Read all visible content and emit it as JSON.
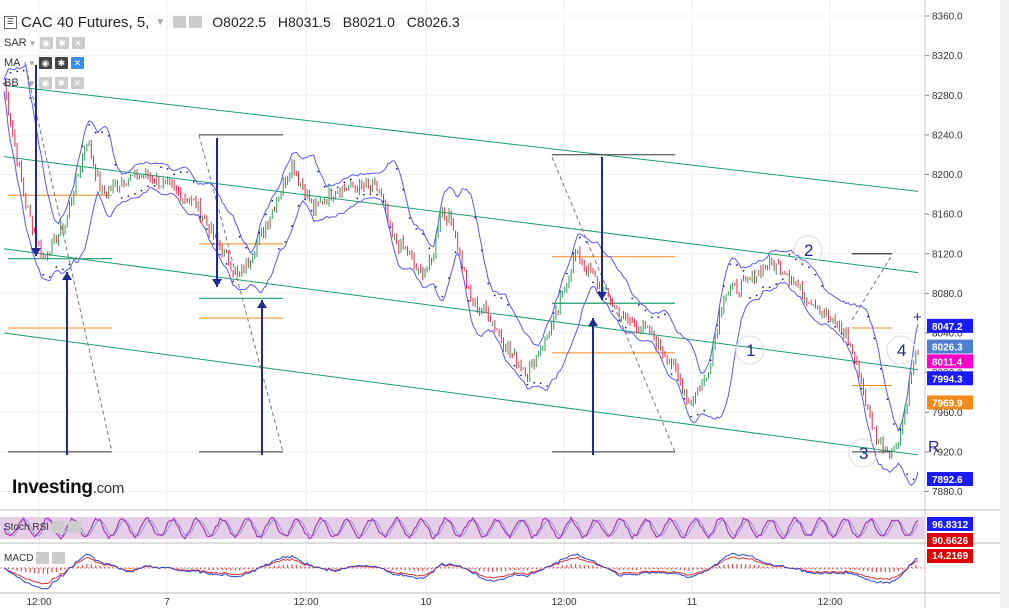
{
  "header": {
    "title": "CAC 40 Futures, 5,",
    "open": "O8022.5",
    "high": "H8031.5",
    "low": "B8021.0",
    "close": "C8026.3"
  },
  "indicators": [
    {
      "name": "SAR"
    },
    {
      "name": "MA"
    },
    {
      "name": "BB"
    }
  ],
  "logo": {
    "main": "Investing",
    "suffix": ".com"
  },
  "stoch_label": "Stoch RSI",
  "macd_label": "MACD",
  "price_badges": [
    {
      "label": "8047.2",
      "value": 8047.2,
      "color": "#1a1aff"
    },
    {
      "label": "8026.3",
      "value": 8026.3,
      "color": "#4f7fd1"
    },
    {
      "label": "8011.4",
      "value": 8011.4,
      "color": "#ff00c8"
    },
    {
      "label": "7994.3",
      "value": 7994.3,
      "color": "#1a1aff"
    },
    {
      "label": "7969.9",
      "value": 7969.9,
      "color": "#f28a1b"
    },
    {
      "label": "7892.6",
      "value": 7892.6,
      "color": "#1a1aff"
    }
  ],
  "stoch_badges": [
    {
      "label": "96.8312",
      "color": "#1a1aff"
    },
    {
      "label": "90.6626",
      "color": "#e00000"
    }
  ],
  "macd_badges": [
    {
      "label": "14.2169",
      "color": "#e00000"
    }
  ],
  "wave_labels": [
    "1",
    "2",
    "3",
    "4"
  ],
  "r_label": "R",
  "plus_label": "+",
  "colors": {
    "up": "#2e9e5a",
    "down": "#e0304a",
    "channel": "#1aa06b",
    "bollinger": "#5a5ae6",
    "arrow": "#1f2a8a",
    "orange": "#f28a1b",
    "green_line": "#1aa06b",
    "stoch": "#a040b0",
    "stoch_bg": "#e6cde8"
  },
  "chart_data": {
    "type": "candlestick",
    "title": "CAC 40 Futures, 5,",
    "y_axis": {
      "ticks": [
        "8360.0",
        "8320.0",
        "8280.0",
        "8240.0",
        "8200.0",
        "8160.0",
        "8120.0",
        "8080.0",
        "8040.0",
        "8000.0",
        "7960.0",
        "7920.0",
        "7880.0"
      ],
      "range": [
        7870,
        8370
      ]
    },
    "x_axis": {
      "ticks": [
        "12:00",
        "7",
        "12:00",
        "10",
        "12:00",
        "11",
        "12:00"
      ]
    },
    "price_path": [
      [
        0,
        8290
      ],
      [
        10,
        8170
      ],
      [
        18,
        8115
      ],
      [
        28,
        8150
      ],
      [
        38,
        8235
      ],
      [
        45,
        8180
      ],
      [
        55,
        8195
      ],
      [
        65,
        8200
      ],
      [
        75,
        8188
      ],
      [
        88,
        8170
      ],
      [
        98,
        8130
      ],
      [
        108,
        8095
      ],
      [
        120,
        8150
      ],
      [
        132,
        8210
      ],
      [
        142,
        8165
      ],
      [
        152,
        8185
      ],
      [
        162,
        8188
      ],
      [
        172,
        8185
      ],
      [
        178,
        8135
      ],
      [
        184,
        8125
      ],
      [
        190,
        8100
      ],
      [
        196,
        8110
      ],
      [
        200,
        8165
      ],
      [
        206,
        8150
      ],
      [
        214,
        8070
      ],
      [
        222,
        8060
      ],
      [
        232,
        8020
      ],
      [
        240,
        8000
      ],
      [
        252,
        8050
      ],
      [
        262,
        8120
      ],
      [
        274,
        8085
      ],
      [
        284,
        8055
      ],
      [
        296,
        8040
      ],
      [
        306,
        8010
      ],
      [
        314,
        7970
      ],
      [
        322,
        7995
      ],
      [
        330,
        8080
      ],
      [
        340,
        8090
      ],
      [
        350,
        8110
      ],
      [
        358,
        8105
      ],
      [
        366,
        8080
      ],
      [
        372,
        8070
      ],
      [
        380,
        8050
      ],
      [
        386,
        8040
      ],
      [
        392,
        8000
      ],
      [
        396,
        7960
      ],
      [
        400,
        7935
      ],
      [
        404,
        7925
      ],
      [
        408,
        7920
      ],
      [
        412,
        7950
      ],
      [
        416,
        8000
      ],
      [
        419,
        8026.3
      ]
    ],
    "channel_lines": [
      {
        "name": "upper",
        "from": [
          0,
          8290
        ],
        "to": [
          419,
          8183
        ]
      },
      {
        "name": "mid_upper",
        "from": [
          0,
          8218
        ],
        "to": [
          419,
          8101
        ]
      },
      {
        "name": "mid_lower",
        "from": [
          0,
          8125
        ],
        "to": [
          419,
          8003
        ]
      },
      {
        "name": "lower",
        "from": [
          0,
          8040
        ],
        "to": [
          419,
          7917
        ]
      }
    ],
    "stoch_rsi": {
      "last": 96.8312,
      "signal": 90.6626
    },
    "macd": {
      "last": 14.2169
    }
  }
}
